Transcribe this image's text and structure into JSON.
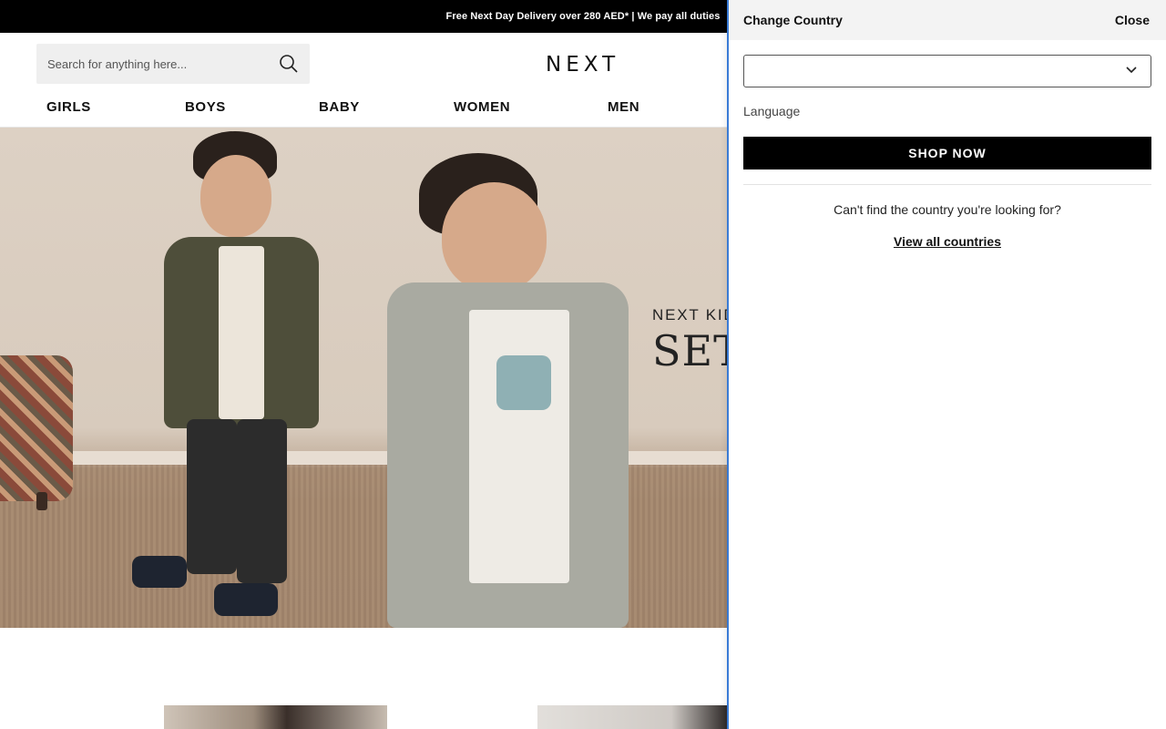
{
  "promo": {
    "text": "Free Next Day Delivery over 280 AED* | We pay all duties"
  },
  "header": {
    "search_placeholder": "Search for anything here...",
    "logo": "NEXT"
  },
  "nav": {
    "items": [
      {
        "label": "GIRLS"
      },
      {
        "label": "BOYS"
      },
      {
        "label": "BABY"
      },
      {
        "label": "WOMEN"
      },
      {
        "label": "MEN"
      }
    ]
  },
  "hero": {
    "eyebrow": "NEXT KID",
    "title": "SET"
  },
  "country_panel": {
    "title": "Change Country",
    "close_label": "Close",
    "country_select_value": "",
    "language_label": "Language",
    "shop_button": "SHOP NOW",
    "help_text": "Can't find the country you're looking for?",
    "all_countries_link": "View all countries"
  },
  "colors": {
    "promo_bg": "#000000",
    "accent_border": "#3a7bd5",
    "button_bg": "#000000"
  }
}
